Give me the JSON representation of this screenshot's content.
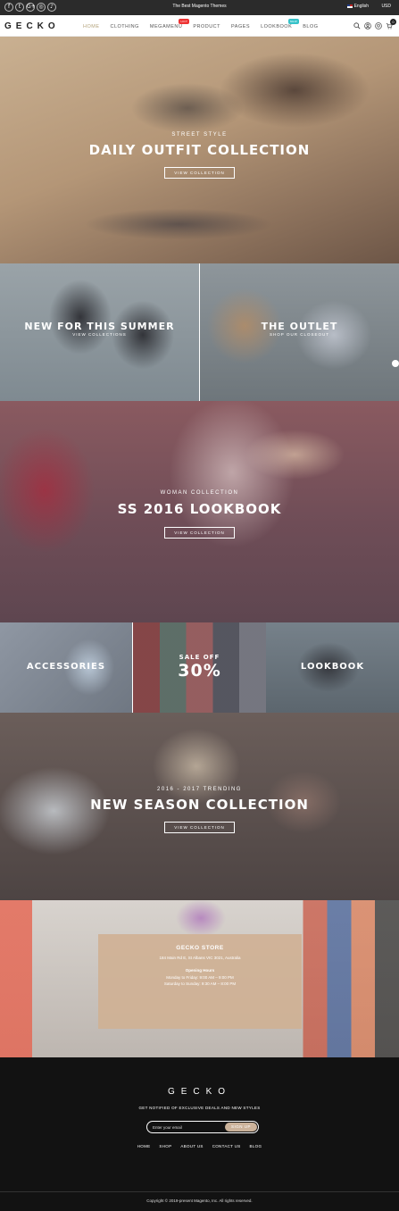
{
  "topbar": {
    "socials": [
      "f",
      "t",
      "G+",
      "◎",
      "♪"
    ],
    "promo": "The Best Magento Themes",
    "language": "English",
    "currency": "USD"
  },
  "header": {
    "logo": "GECKO",
    "nav": [
      {
        "label": "HOME",
        "badge": ""
      },
      {
        "label": "CLOTHING",
        "badge": ""
      },
      {
        "label": "MEGAMENU",
        "badge": "HOT"
      },
      {
        "label": "PRODUCT",
        "badge": ""
      },
      {
        "label": "PAGES",
        "badge": ""
      },
      {
        "label": "LOOKBOOK",
        "badge": "NEW"
      },
      {
        "label": "BLOG",
        "badge": ""
      }
    ],
    "cart_count": "0"
  },
  "hero1": {
    "subtitle": "STREET STYLE",
    "title": "DAILY OUTFIT COLLECTION",
    "button": "VIEW COLLECTION"
  },
  "tiles": [
    {
      "title": "NEW FOR THIS SUMMER",
      "link": "VIEW COLLECTIONS"
    },
    {
      "title": "THE OUTLET",
      "link": "SHOP OUR CLOSEOUT"
    }
  ],
  "hero2": {
    "subtitle": "WOMAN COLLECTION",
    "title": "SS 2016 LOOKBOOK",
    "button": "VIEW COLLECTION"
  },
  "categories": {
    "left": "ACCESSORIES",
    "middle_small": "SALE OFF",
    "middle_big": "30%",
    "right": "LOOKBOOK"
  },
  "hero3": {
    "subtitle": "2016 - 2017 TRENDING",
    "title": "NEW SEASON COLLECTION",
    "button": "VIEW COLLECTION"
  },
  "store": {
    "name": "GECKO STORE",
    "address": "184 Main Rd E, St Albans VIC 3021, Australia",
    "hours_title": "Opening Hours",
    "hours_weekday": "Monday to Friday: 9:00 AM – 9:00 PM",
    "hours_weekend": "Saturday to Sunday: 9:30 AM – 8:00 PM"
  },
  "footer": {
    "logo": "GECKO",
    "subtitle": "GET NOTIFIED OF EXCLUSIVE DEALS AND NEW STYLES",
    "email_placeholder": "Enter your email",
    "signup": "SIGN UP",
    "links": [
      "HOME",
      "SHOP",
      "ABOUT US",
      "CONTACT US",
      "BLOG"
    ],
    "copyright": "Copyright © 2019-present Magento, Inc. All rights reserved."
  }
}
